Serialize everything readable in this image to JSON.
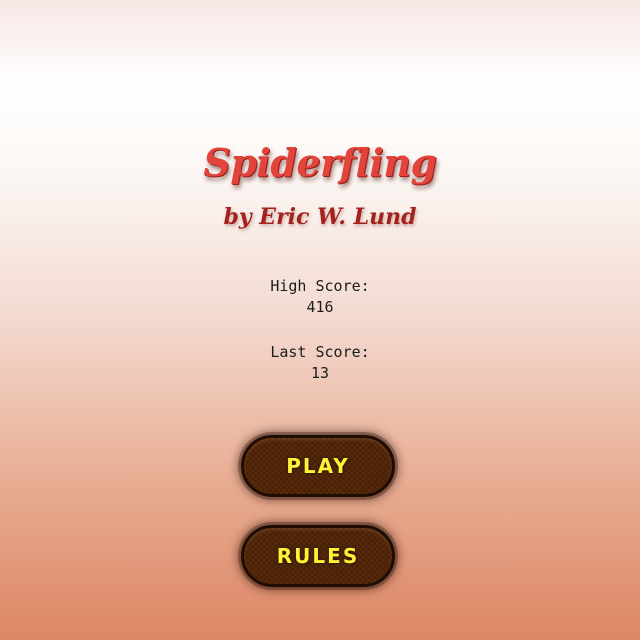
{
  "game": {
    "title": "Spiderfling",
    "byline": "by Eric W. Lund"
  },
  "scores": {
    "high_label": "High Score:",
    "high_value": "416",
    "last_label": "Last Score:",
    "last_value": "13"
  },
  "buttons": {
    "play_label": "PLAY",
    "rules_label": "RULES"
  },
  "colors": {
    "title": "#e2433b",
    "byline": "#a3221c",
    "button_fill": "#5b2a0a",
    "button_text": "#fff338"
  }
}
